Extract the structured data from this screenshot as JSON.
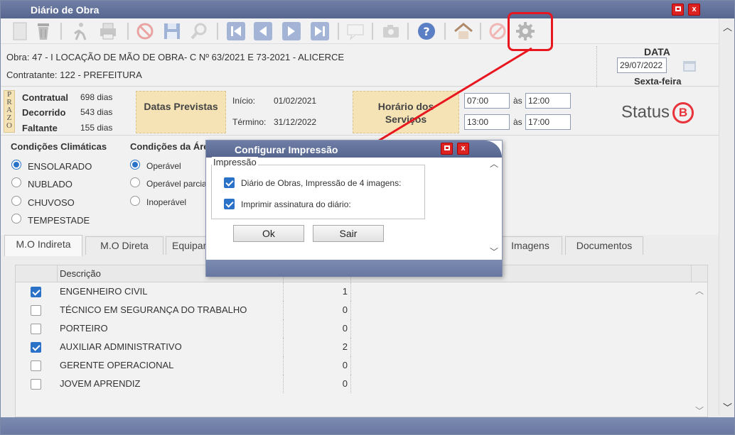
{
  "window": {
    "title": "Diário de Obra"
  },
  "header": {
    "obra": "Obra: 47 - I LOCAÇÃO DE MÃO DE OBRA- C Nº 63/2021 E 73-2021 - ALICERCE",
    "contratante": "Contratante: 122 - PREFEITURA",
    "data_label": "DATA",
    "date_value": "29/07/2022",
    "weekday": "Sexta-feira"
  },
  "prazo": {
    "letters": [
      "P",
      "R",
      "A",
      "Z",
      "O"
    ],
    "rows": [
      {
        "label": "Contratual",
        "value": "698 dias"
      },
      {
        "label": "Decorrido",
        "value": "543 dias"
      },
      {
        "label": "Faltante",
        "value": "155 dias"
      }
    ]
  },
  "datas": {
    "label": "Datas Previstas",
    "inicio_label": "Início:",
    "inicio": "01/02/2021",
    "termino_label": "Término:",
    "termino": "31/12/2022"
  },
  "horario": {
    "label": "Horário dos Serviços",
    "sep": "às",
    "t1": "07:00",
    "t2": "12:00",
    "t3": "13:00",
    "t4": "17:00"
  },
  "status": {
    "label": "Status",
    "badge": "B"
  },
  "clima": {
    "title": "Condições Climáticas",
    "options": [
      "ENSOLARADO",
      "NUBLADO",
      "CHUVOSO",
      "TEMPESTADE"
    ]
  },
  "area": {
    "title": "Condições da Áre",
    "options": [
      "Operável",
      "Operável parcia",
      "Inoperável"
    ]
  },
  "tabs": [
    "M.O Indireta",
    "M.O Direta",
    "Equipar",
    "Imagens",
    "Documentos"
  ],
  "grid": {
    "header_desc": "Descrição",
    "rows": [
      {
        "desc": "ENGENHEIRO CIVIL",
        "qty": "1",
        "checked": true
      },
      {
        "desc": "TÉCNICO EM SEGURANÇA DO TRABALHO",
        "qty": "0",
        "checked": false
      },
      {
        "desc": "PORTEIRO",
        "qty": "0",
        "checked": false
      },
      {
        "desc": "AUXILIAR ADMINISTRATIVO",
        "qty": "2",
        "checked": true
      },
      {
        "desc": "GERENTE OPERACIONAL",
        "qty": "0",
        "checked": false
      },
      {
        "desc": "JOVEM APRENDIZ",
        "qty": "0",
        "checked": false
      }
    ]
  },
  "dialog": {
    "title": "Configurar Impressão",
    "group": "Impressão",
    "opt1": "Diário de Obras, Impressão de 4 imagens:",
    "opt2": "Imprimir assinatura do diário:",
    "ok": "Ok",
    "sair": "Sair"
  },
  "colors": {
    "accent": "#2a72c8",
    "highlight": "#e8161f",
    "titlebar": "#6272a0"
  }
}
